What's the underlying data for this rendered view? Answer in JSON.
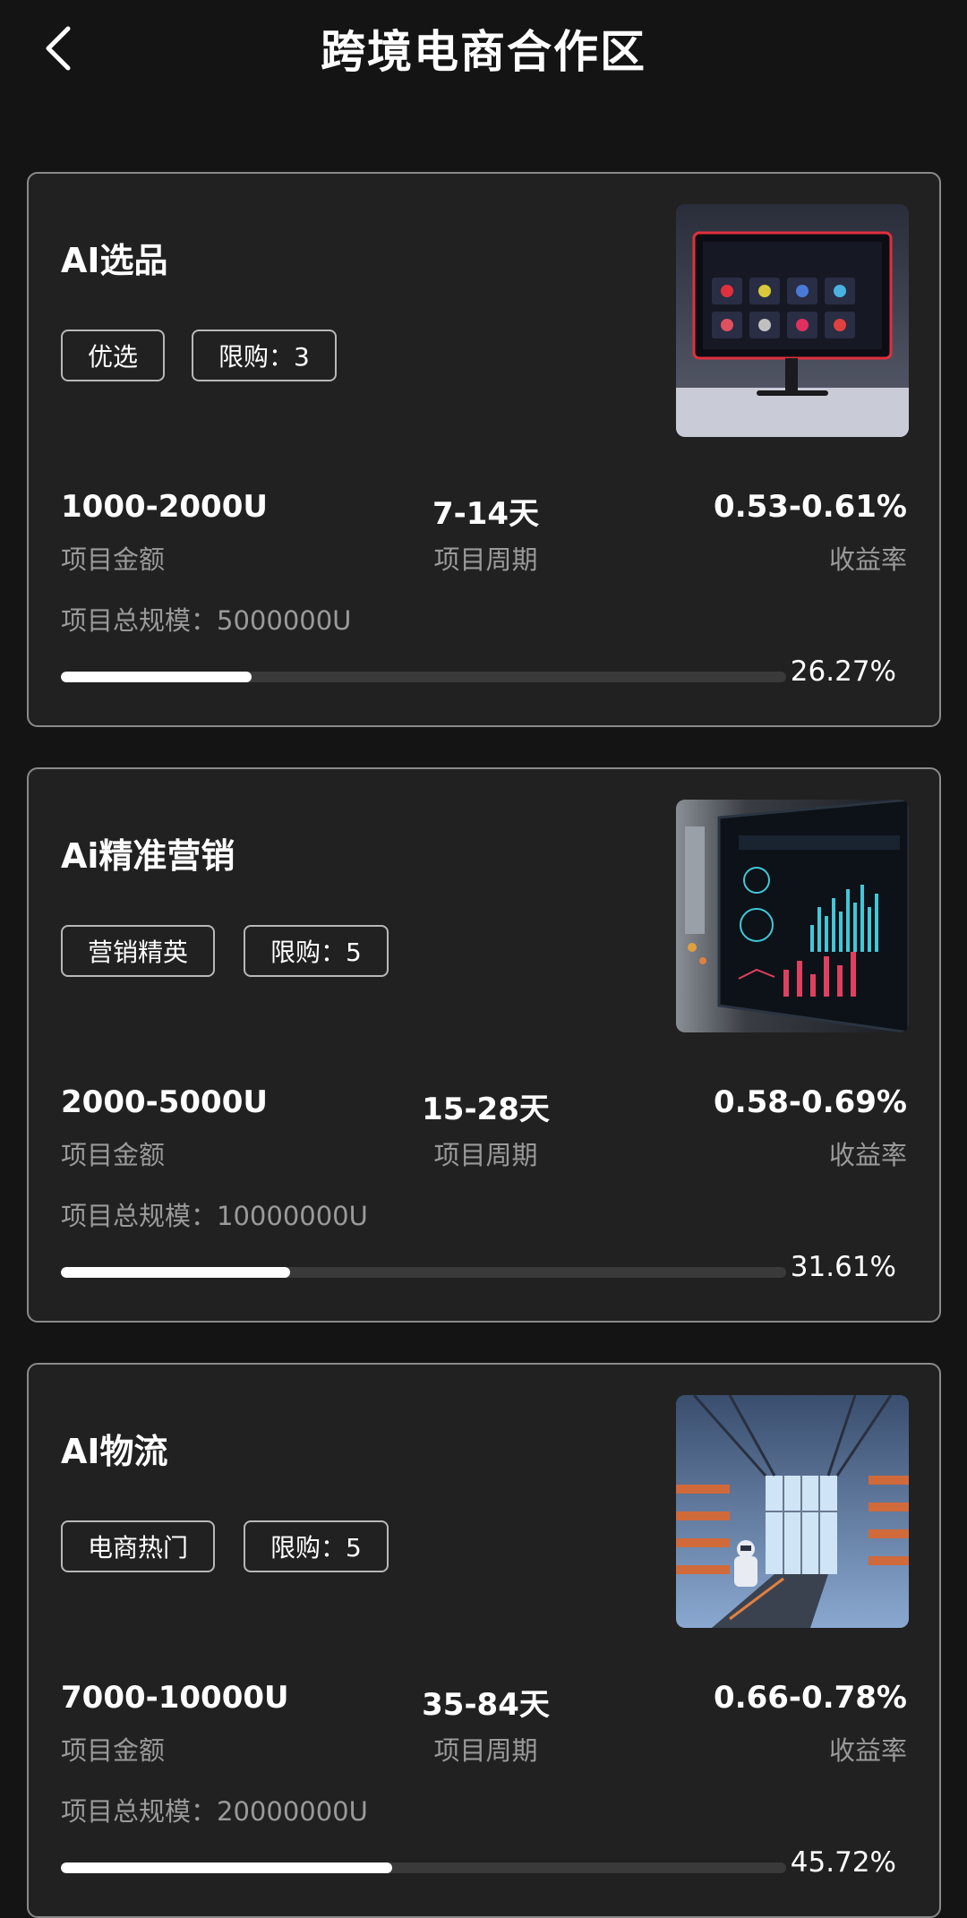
{
  "header": {
    "title": "跨境电商合作区",
    "back_icon": "chevron-left-icon"
  },
  "colors": {
    "background": "#141414",
    "card": "#212121",
    "card_border": "#8a8a8a",
    "progress_fill": "#ffffff",
    "progress_track": "#3a3a3a",
    "muted_text": "#9a9a9a"
  },
  "cards": [
    {
      "title": "AI选品",
      "tags": [
        "优选",
        "限购：3"
      ],
      "image": "ai-product-monitor-image",
      "amount_value": "1000-2000U",
      "amount_label": "项目金额",
      "period_value": "7-14天",
      "period_label": "项目周期",
      "rate_value": "0.53-0.61%",
      "rate_label": "收益率",
      "scale_label": "项目总规模：",
      "scale_value": "5000000U",
      "progress": 26.27,
      "progress_text": "26.27%"
    },
    {
      "title": "Ai精准营销",
      "tags": [
        "营销精英",
        "限购：5"
      ],
      "image": "marketing-dashboard-image",
      "amount_value": "2000-5000U",
      "amount_label": "项目金额",
      "period_value": "15-28天",
      "period_label": "项目周期",
      "rate_value": "0.58-0.69%",
      "rate_label": "收益率",
      "scale_label": "项目总规模：",
      "scale_value": "10000000U",
      "progress": 31.61,
      "progress_text": "31.61%"
    },
    {
      "title": "AI物流",
      "tags": [
        "电商热门",
        "限购：5"
      ],
      "image": "logistics-warehouse-image",
      "amount_value": "7000-10000U",
      "amount_label": "项目金额",
      "period_value": "35-84天",
      "period_label": "项目周期",
      "rate_value": "0.66-0.78%",
      "rate_label": "收益率",
      "scale_label": "项目总规模：",
      "scale_value": "20000000U",
      "progress": 45.72,
      "progress_text": "45.72%"
    }
  ]
}
